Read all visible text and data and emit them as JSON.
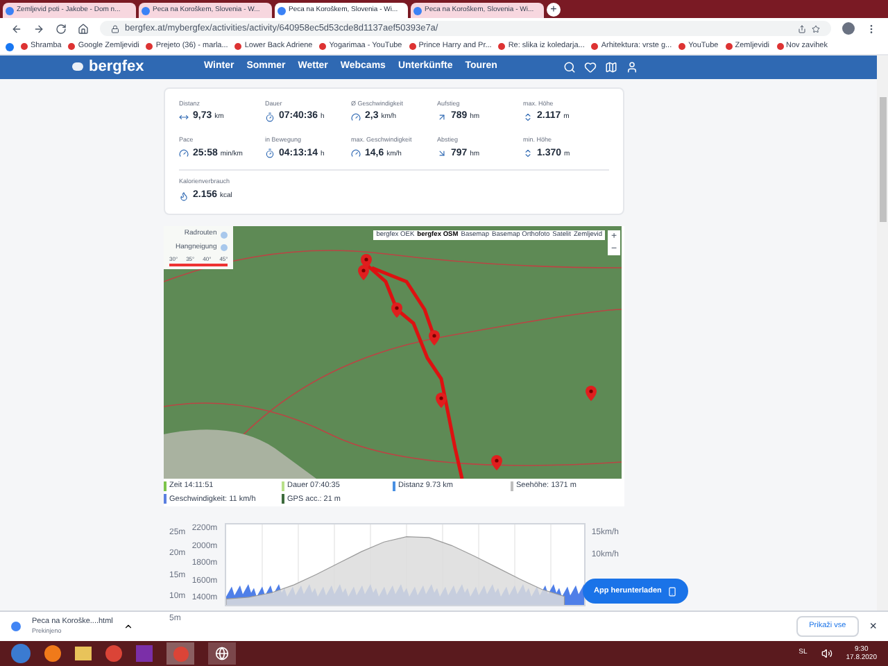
{
  "browser": {
    "tabs": [
      {
        "title": "Zemljevid poti - Jakobe - Dom n...",
        "selected": false
      },
      {
        "title": "Peca na Koroškem, Slovenia - W...",
        "selected": false
      },
      {
        "title": "Peca na Koroškem, Slovenia - Wi...",
        "selected": true
      },
      {
        "title": "Peca na Koroškem, Slovenia - Wi...",
        "selected": false
      }
    ],
    "new_tab": "+",
    "url": "bergfex.at/mybergfex/activities/activity/640958ec5d53cde8d1137aef50393e7a/",
    "bookmarks": [
      "Shramba",
      "Google Zemljevidi",
      "Prejeto (36) - marla...",
      "Lower Back Adriene",
      "Yogarimaa - YouTube",
      "Prince Harry and Pr...",
      "Re: slika iz koledarja...",
      "Arhitektura: vrste g...",
      "YouTube",
      "Zemljevidi",
      "Nov zavihek"
    ]
  },
  "site": {
    "logo": "bergfex",
    "nav": [
      "Winter",
      "Sommer",
      "Wetter",
      "Webcams",
      "Unterkünfte",
      "Touren"
    ]
  },
  "stats": [
    {
      "label": "Distanz",
      "value": "9,73",
      "unit": "km"
    },
    {
      "label": "Dauer",
      "value": "07:40:36",
      "unit": "h"
    },
    {
      "label": "Ø Geschwindigkeit",
      "value": "2,3",
      "unit": "km/h"
    },
    {
      "label": "Aufstieg",
      "value": "789",
      "unit": "hm"
    },
    {
      "label": "max. Höhe",
      "value": "2.117",
      "unit": "m"
    },
    {
      "label": "Pace",
      "value": "25:58",
      "unit": "min/km"
    },
    {
      "label": "in Bewegung",
      "value": "04:13:14",
      "unit": "h"
    },
    {
      "label": "max. Geschwindigkeit",
      "value": "14,6",
      "unit": "km/h"
    },
    {
      "label": "Abstieg",
      "value": "797",
      "unit": "hm"
    },
    {
      "label": "min. Höhe",
      "value": "1.370",
      "unit": "m"
    }
  ],
  "calories": {
    "label": "Kalorienverbrauch",
    "value": "2.156",
    "unit": "kcal"
  },
  "map": {
    "legend": [
      {
        "label": "Radrouten"
      },
      {
        "label": "Hangneigung"
      }
    ],
    "slope_ticks": [
      "30°",
      "35°",
      "40°",
      "45°"
    ],
    "layers": [
      {
        "label": "bergfex OEK",
        "selected": false
      },
      {
        "label": "bergfex OSM",
        "selected": true
      },
      {
        "label": "Basemap",
        "selected": false
      },
      {
        "label": "Basemap Orthofoto",
        "selected": false
      },
      {
        "label": "Satelit",
        "selected": false
      },
      {
        "label": "Zemljevid",
        "selected": false
      }
    ],
    "zoom_in": "+",
    "zoom_out": "−"
  },
  "track_info": [
    {
      "text": "Zeit 14:11:51",
      "color": "#7cc44a"
    },
    {
      "text": "Dauer 07:40:35",
      "color": "#b8e08a"
    },
    {
      "text": "Distanz 9.73 km",
      "color": "#4a90e2"
    },
    {
      "text": "Seehöhe: 1371 m",
      "color": "#bdbdbd"
    },
    {
      "text": "Geschwindigkeit: 11 km/h",
      "color": "#5b7fe0"
    },
    {
      "text": "GPS acc.: 21 m",
      "color": "#3d6b3d"
    }
  ],
  "profile": {
    "left_axis_labels": [
      "25m",
      "20m",
      "15m",
      "10m",
      "5m"
    ],
    "right_axis_labels": [
      "15km/h",
      "10km/h"
    ],
    "chart_data": {
      "type": "area",
      "ylim": [
        1300,
        2250
      ],
      "yticks": [
        {
          "value": 2200,
          "label": "2200m"
        },
        {
          "value": 2000,
          "label": "2000m"
        },
        {
          "value": 1800,
          "label": "1800m"
        },
        {
          "value": 1600,
          "label": "1600m"
        },
        {
          "value": 1400,
          "label": "1400m"
        }
      ],
      "series": [
        {
          "color": "#dcdcdc",
          "values": [
            1400,
            1420,
            1470,
            1560,
            1680,
            1810,
            1940,
            2050,
            2110,
            2100,
            2010,
            1890,
            1760,
            1630,
            1510,
            1430,
            null
          ]
        }
      ]
    }
  },
  "app_button": "App herunterladen",
  "download": {
    "file": "Peca na Koroške....html",
    "status": "Prekinjeno",
    "show_all": "Prikaži vse",
    "close": "×"
  },
  "taskbar": {
    "language": "SL",
    "time": "9:30",
    "date": "17.8.2020"
  }
}
